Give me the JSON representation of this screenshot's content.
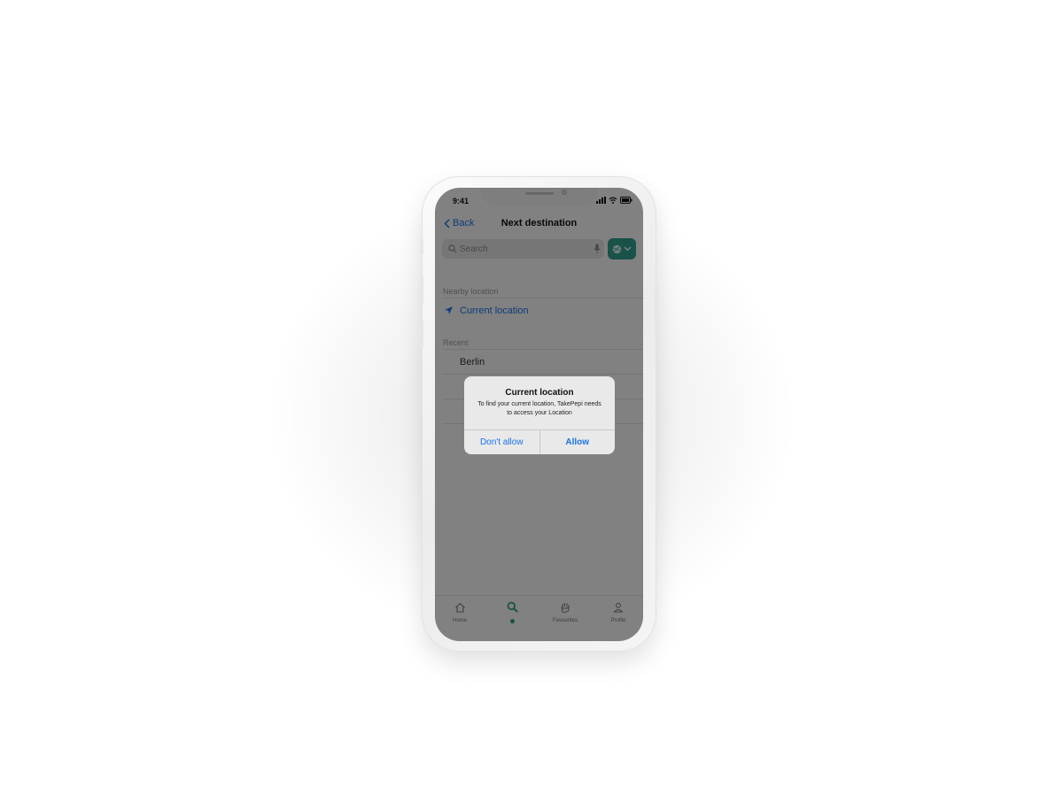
{
  "status_bar": {
    "time": "9:41"
  },
  "nav": {
    "back_label": "Back",
    "title": "Next destination"
  },
  "search": {
    "placeholder": "Search"
  },
  "sections": {
    "nearby_label": "Nearby location",
    "current_location": "Current location",
    "recent_label": "Recent",
    "recent_items": [
      "Berlin",
      "",
      ""
    ]
  },
  "tabs": [
    {
      "label": "Home",
      "icon": "home-icon"
    },
    {
      "label": "",
      "icon": "search-icon",
      "active": true
    },
    {
      "label": "Favourites",
      "icon": "hand-icon"
    },
    {
      "label": "Profile",
      "icon": "profile-icon"
    }
  ],
  "alert": {
    "title": "Current location",
    "message": "To find your current location, TakePepi needs to access your Location",
    "deny_label": "Don't allow",
    "allow_label": "Allow"
  },
  "colors": {
    "accent": "#1a73e8",
    "brand": "#2f9e8b",
    "overlay": "rgba(0,0,0,0.48)"
  }
}
